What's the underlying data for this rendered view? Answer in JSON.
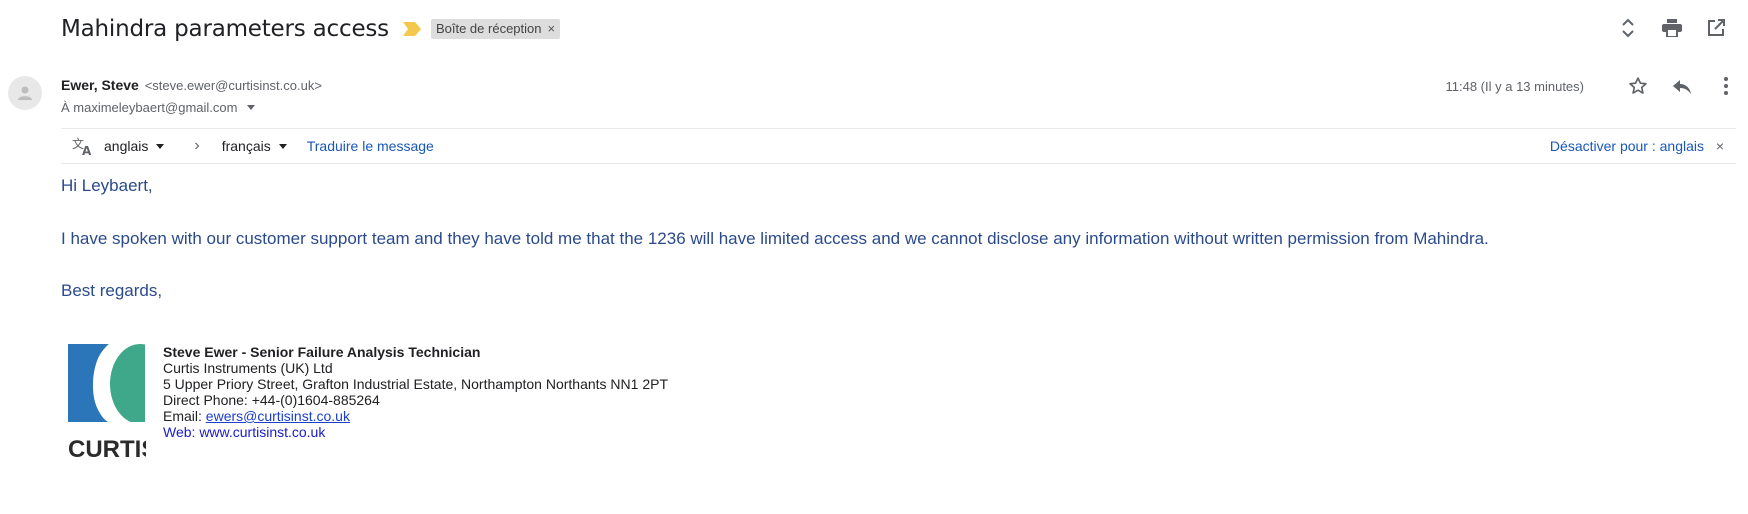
{
  "subject": {
    "title": "Mahindra parameters access",
    "label": "Boîte de réception",
    "label_remove": "×"
  },
  "toolbar": {
    "icons": [
      "expand-collapse-icon",
      "print-icon",
      "open-new-window-icon"
    ]
  },
  "message": {
    "sender_name": "Ewer, Steve",
    "sender_email": "<steve.ewer@curtisinst.co.uk>",
    "to": "À maximeleybaert@gmail.com",
    "time": "11:48 (Il y a 13 minutes)"
  },
  "translate": {
    "source_lang": "anglais",
    "target_lang": "français",
    "translate_link": "Traduire le message",
    "disable_link": "Désactiver pour : anglais",
    "close": "×"
  },
  "body": {
    "greeting": "Hi Leybaert,",
    "paragraph": "I have spoken with our customer support team and they have told me that the 1236 will have limited access and we cannot disclose any information without written permission from Mahindra.",
    "closing": "Best regards,"
  },
  "signature": {
    "name": "Steve Ewer - Senior Failure Analysis Technician",
    "company": "Curtis Instruments (UK) Ltd",
    "address": "5 Upper Priory Street, Grafton Industrial Estate, Northampton Northants NN1 2PT",
    "phone": "Direct Phone: +44-(0)1604-885264",
    "email_label": "Email: ",
    "email": "ewers@curtisinst.co.uk",
    "web": "Web: www.curtisinst.co.uk",
    "logo_text": "CURTIS"
  },
  "colors": {
    "body_text": "#2a4a8c",
    "link": "#1a57b7",
    "importance": "#f2c94c",
    "logo_blue": "#2a76b8",
    "logo_green": "#3fa88a"
  }
}
